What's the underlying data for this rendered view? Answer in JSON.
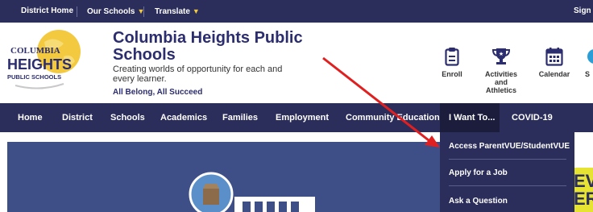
{
  "topbar": {
    "district_home": "District Home",
    "our_schools": "Our Schools",
    "translate": "Translate",
    "sign_in": "Sign"
  },
  "header": {
    "logo_line1": "COLUMBIA",
    "logo_line2": "HEIGHTS",
    "logo_line3": "PUBLIC SCHOOLS",
    "title": "Columbia Heights Public Schools",
    "tagline": "Creating worlds of opportunity for each and every learner.",
    "motto": "All Belong, All Succeed"
  },
  "quick_links": [
    {
      "label": "Enroll",
      "icon": "clipboard-icon"
    },
    {
      "label": "Activities and Athletics",
      "icon": "trophy-icon"
    },
    {
      "label": "Calendar",
      "icon": "calendar-icon"
    },
    {
      "label": "S",
      "icon": "globe-icon"
    }
  ],
  "nav": {
    "items": [
      {
        "label": "Home"
      },
      {
        "label": "District"
      },
      {
        "label": "Schools"
      },
      {
        "label": "Academics"
      },
      {
        "label": "Families"
      },
      {
        "label": "Employment"
      },
      {
        "label": "Community Education"
      },
      {
        "label": "I Want To..."
      },
      {
        "label": "COVID-19"
      }
    ]
  },
  "dropdown": {
    "items": [
      {
        "label": "Access ParentVUE/StudentVUE"
      },
      {
        "label": "Apply for a Job"
      },
      {
        "label": "Ask a Question"
      }
    ]
  },
  "hero": {
    "partial_text": "EV ER"
  },
  "colors": {
    "navy": "#2b2d5a",
    "accent_yellow": "#f3c93f",
    "hero_blue": "#3d4f86",
    "annotation_red": "#e02020"
  }
}
